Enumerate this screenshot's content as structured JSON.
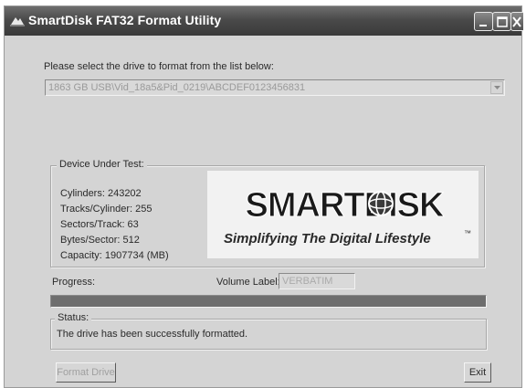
{
  "window": {
    "title": "SmartDisk FAT32 Format Utility",
    "controls": {
      "minimize": "minimize-icon",
      "maximize": "maximize-icon",
      "close": "close-icon"
    }
  },
  "drive_select": {
    "prompt": "Please select the drive to format from the list below:",
    "value": "1863 GB USB\\Vid_18a5&Pid_0219\\ABCDEF0123456831"
  },
  "device": {
    "title": "Device Under Test:",
    "cylinders": "Cylinders: 243202",
    "tracks": "Tracks/Cylinder: 255",
    "sectors": "Sectors/Track: 63",
    "bytes": "Bytes/Sector: 512",
    "capacity": "Capacity:  1907734 (MB)"
  },
  "logo": {
    "brand": "SMARTDISK",
    "tagline": "Simplifying The Digital Lifestyle",
    "tm": "™"
  },
  "progress": {
    "label": "Progress:",
    "value": 1.0
  },
  "volume": {
    "label": "Volume Label:",
    "value": "VERBATIM"
  },
  "status": {
    "title": "Status:",
    "text": "The drive has been successfully formatted."
  },
  "buttons": {
    "format": "Format Drive",
    "exit": "Exit"
  },
  "colors": {
    "window_bg": "#d4d4d4",
    "titlebar": "#4a4a4a",
    "progress_fill": "#6e6e6e"
  }
}
